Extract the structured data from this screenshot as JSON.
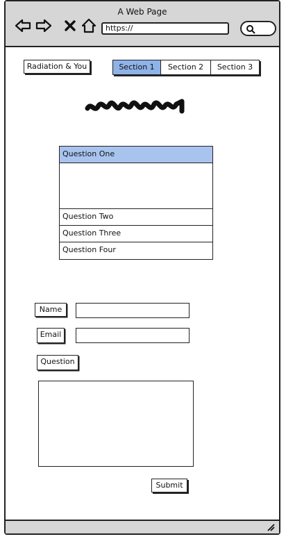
{
  "browser": {
    "page_title": "A Web Page",
    "url": "https://",
    "icons": [
      "back-arrow-icon",
      "forward-arrow-icon",
      "close-icon",
      "home-icon",
      "search-icon"
    ]
  },
  "header": {
    "site_button": "Radiation & You",
    "tabs": [
      {
        "label": "Section 1",
        "active": true
      },
      {
        "label": "Section 2",
        "active": false
      },
      {
        "label": "Section 3",
        "active": false
      }
    ]
  },
  "accordion": {
    "items": [
      {
        "label": "Question One",
        "expanded": true
      },
      {
        "label": "Question Two",
        "expanded": false
      },
      {
        "label": "Question Three",
        "expanded": false
      },
      {
        "label": "Question Four",
        "expanded": false
      }
    ]
  },
  "form": {
    "name_label": "Name",
    "name_value": "",
    "email_label": "Email",
    "email_value": "",
    "question_label": "Question",
    "question_value": "",
    "submit_label": "Submit"
  },
  "colors": {
    "active_tab": "#8fb3e8",
    "open_item": "#a8c4ee",
    "chrome": "#d6d6d6"
  }
}
